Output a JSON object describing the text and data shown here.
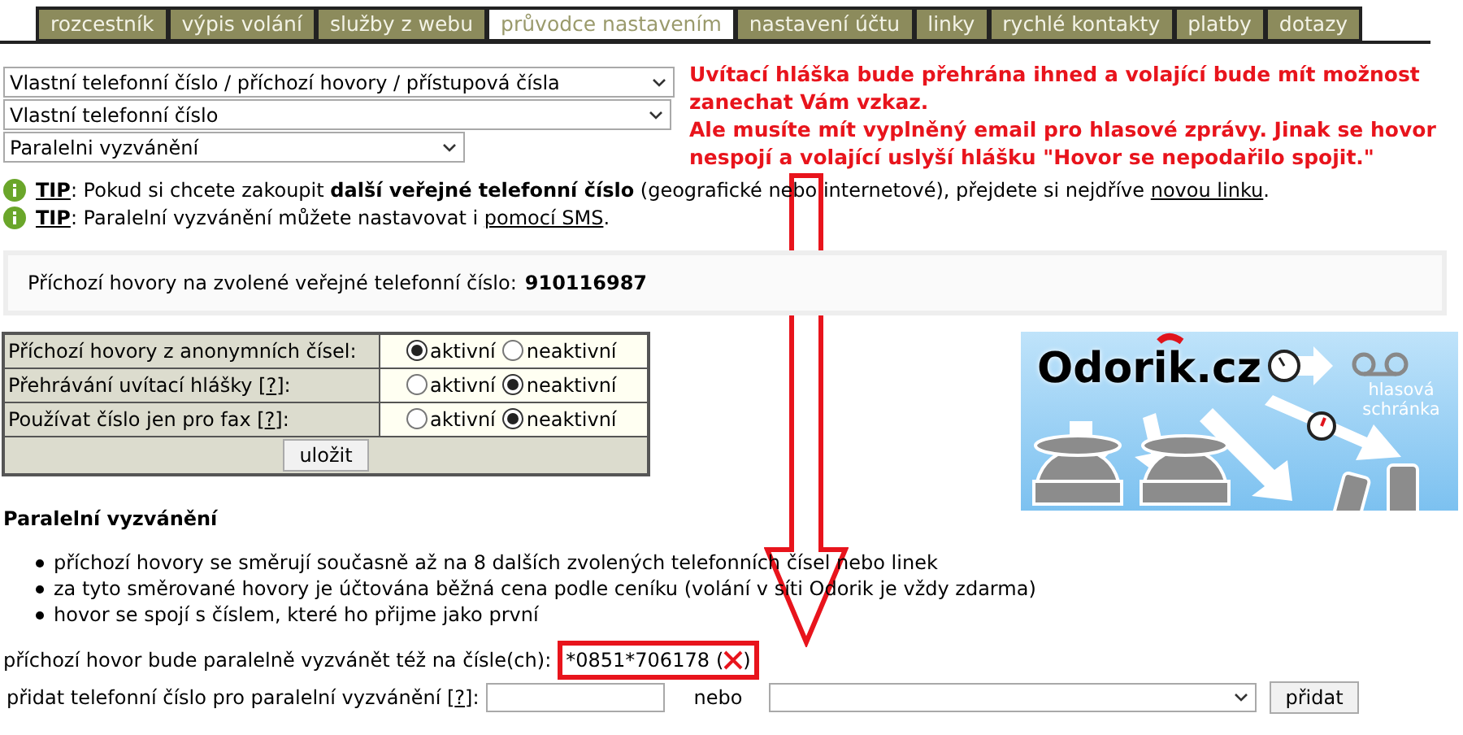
{
  "tabs": [
    {
      "label": "rozcestník",
      "selected": false
    },
    {
      "label": "výpis volání",
      "selected": false
    },
    {
      "label": "služby z webu",
      "selected": false
    },
    {
      "label": "průvodce nastavením",
      "selected": true
    },
    {
      "label": "nastavení účtu",
      "selected": false
    },
    {
      "label": "linky",
      "selected": false
    },
    {
      "label": "rychlé kontakty",
      "selected": false
    },
    {
      "label": "platby",
      "selected": false
    },
    {
      "label": "dotazy",
      "selected": false
    }
  ],
  "selects": [
    {
      "value": "Vlastní telefonní číslo / příchozí hovory / přístupová čísla"
    },
    {
      "value": "Vlastní telefonní číslo"
    },
    {
      "value": "Paralelni vyzvánění"
    }
  ],
  "note": [
    "Uvítací hláška bude přehrána ihned a volající bude mít možnost zanechat Vám vzkaz.",
    "Ale musíte mít vyplněný email pro hlasové zprávy. Jinak se hovor nespojí a volající uslyší hlášku \"Hovor se nepodařilo spojit.\""
  ],
  "tips": [
    {
      "label": "TIP",
      "text": ": Pokud si chcete zakoupit **další veřejné telefonní číslo** (geografické nebo internetové), přejdete si nejdříve ",
      "link": "novou linku",
      "after": "."
    },
    {
      "label": "TIP",
      "text": ": Paralelní vyzvánění můžete nastavovat i ",
      "link": "pomocí SMS",
      "after": "."
    }
  ],
  "number_box": {
    "label": "Příchozí hovory na zvolené veřejné telefonní číslo:",
    "number": "910116987"
  },
  "settings": {
    "rows": [
      {
        "label": "Příchozí hovory z anonymních čísel:",
        "options": [
          {
            "label": "aktivní",
            "selected": true
          },
          {
            "label": "neaktivní",
            "selected": false
          }
        ]
      },
      {
        "label": "Přehrávání uvítací hlášky [",
        "help": "?",
        "after": "]:",
        "options": [
          {
            "label": "aktivní",
            "selected": false
          },
          {
            "label": "neaktivní",
            "selected": true
          }
        ]
      },
      {
        "label": "Používat číslo jen pro fax [",
        "help": "?",
        "after": "]:",
        "options": [
          {
            "label": "aktivní",
            "selected": false
          },
          {
            "label": "neaktivní",
            "selected": true
          }
        ]
      }
    ],
    "save": "uložit"
  },
  "banner": {
    "logo": "Odorik",
    "logo_tld": ".cz",
    "voicemail": "hlasová schránka"
  },
  "section": {
    "title": "Paralelní vyzvánění",
    "bullets": [
      "příchozí hovory se směrují současně až na 8 dalších zvolených telefonních čísel nebo linek",
      "za tyto směrované hovory je účtována běžná cena podle ceníku (volání v síti Odorik je vždy zdarma)",
      "hovor se spojí s číslem, které ho přijme jako první"
    ]
  },
  "parallel": {
    "label": "příchozí hovor bude paralelně vyzvánět též na čísle(ch):",
    "number": "*0851*706178",
    "open": "(",
    "close": ")"
  },
  "add": {
    "label": "přidat telefonní číslo pro paralelní vyzvánění [",
    "help": "?",
    "after": "]:",
    "or": "nebo",
    "button": "přidat"
  }
}
